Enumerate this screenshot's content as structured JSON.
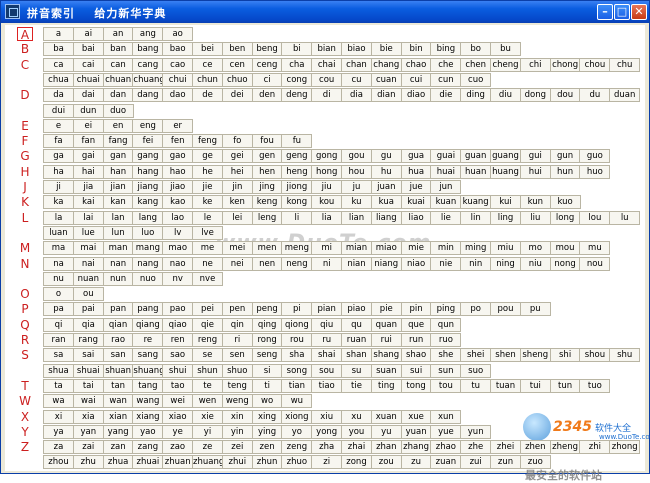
{
  "window": {
    "title": "拼音索引    给力新华字典",
    "minimize_icon": "minimize-icon",
    "maximize_icon": "maximize-icon",
    "close_icon": "close-icon"
  },
  "watermark": {
    "text": "www.DuoTe.com",
    "logo_nums": "2345",
    "logo_brand": "软件大全",
    "logo_sub": "www.DuoTe.com",
    "bottom_text": "最安全的软件站"
  },
  "rows": [
    {
      "letter": "A",
      "syllables": [
        "a",
        "ai",
        "an",
        "ang",
        "ao"
      ]
    },
    {
      "letter": "B",
      "syllables": [
        "ba",
        "bai",
        "ban",
        "bang",
        "bao",
        "bei",
        "ben",
        "beng",
        "bi",
        "bian",
        "biao",
        "bie",
        "bin",
        "bing",
        "bo",
        "bu"
      ]
    },
    {
      "letter": "C",
      "syllables": [
        "ca",
        "cai",
        "can",
        "cang",
        "cao",
        "ce",
        "cen",
        "ceng",
        "cha",
        "chai",
        "chan",
        "chang",
        "chao",
        "che",
        "chen",
        "cheng",
        "chi",
        "chong",
        "chou",
        "chu"
      ]
    },
    {
      "letter": "",
      "syllables": [
        "chua",
        "chuai",
        "chuan",
        "chuang",
        "chui",
        "chun",
        "chuo",
        "ci",
        "cong",
        "cou",
        "cu",
        "cuan",
        "cui",
        "cun",
        "cuo"
      ]
    },
    {
      "letter": "D",
      "syllables": [
        "da",
        "dai",
        "dan",
        "dang",
        "dao",
        "de",
        "dei",
        "den",
        "deng",
        "di",
        "dia",
        "dian",
        "diao",
        "die",
        "ding",
        "diu",
        "dong",
        "dou",
        "du",
        "duan"
      ]
    },
    {
      "letter": "",
      "syllables": [
        "dui",
        "dun",
        "duo"
      ]
    },
    {
      "letter": "E",
      "syllables": [
        "e",
        "ei",
        "en",
        "eng",
        "er"
      ]
    },
    {
      "letter": "F",
      "syllables": [
        "fa",
        "fan",
        "fang",
        "fei",
        "fen",
        "feng",
        "fo",
        "fou",
        "fu"
      ]
    },
    {
      "letter": "G",
      "syllables": [
        "ga",
        "gai",
        "gan",
        "gang",
        "gao",
        "ge",
        "gei",
        "gen",
        "geng",
        "gong",
        "gou",
        "gu",
        "gua",
        "guai",
        "guan",
        "guang",
        "gui",
        "gun",
        "guo"
      ]
    },
    {
      "letter": "H",
      "syllables": [
        "ha",
        "hai",
        "han",
        "hang",
        "hao",
        "he",
        "hei",
        "hen",
        "heng",
        "hong",
        "hou",
        "hu",
        "hua",
        "huai",
        "huan",
        "huang",
        "hui",
        "hun",
        "huo"
      ]
    },
    {
      "letter": "J",
      "syllables": [
        "ji",
        "jia",
        "jian",
        "jiang",
        "jiao",
        "jie",
        "jin",
        "jing",
        "jiong",
        "jiu",
        "ju",
        "juan",
        "jue",
        "jun"
      ]
    },
    {
      "letter": "K",
      "syllables": [
        "ka",
        "kai",
        "kan",
        "kang",
        "kao",
        "ke",
        "ken",
        "keng",
        "kong",
        "kou",
        "ku",
        "kua",
        "kuai",
        "kuan",
        "kuang",
        "kui",
        "kun",
        "kuo"
      ]
    },
    {
      "letter": "L",
      "syllables": [
        "la",
        "lai",
        "lan",
        "lang",
        "lao",
        "le",
        "lei",
        "leng",
        "li",
        "lia",
        "lian",
        "liang",
        "liao",
        "lie",
        "lin",
        "ling",
        "liu",
        "long",
        "lou",
        "lu"
      ]
    },
    {
      "letter": "",
      "syllables": [
        "luan",
        "lue",
        "lun",
        "luo",
        "lv",
        "lve"
      ]
    },
    {
      "letter": "M",
      "syllables": [
        "ma",
        "mai",
        "man",
        "mang",
        "mao",
        "me",
        "mei",
        "men",
        "meng",
        "mi",
        "mian",
        "miao",
        "mie",
        "min",
        "ming",
        "miu",
        "mo",
        "mou",
        "mu"
      ]
    },
    {
      "letter": "N",
      "syllables": [
        "na",
        "nai",
        "nan",
        "nang",
        "nao",
        "ne",
        "nei",
        "nen",
        "neng",
        "ni",
        "nian",
        "niang",
        "niao",
        "nie",
        "nin",
        "ning",
        "niu",
        "nong",
        "nou"
      ]
    },
    {
      "letter": "",
      "syllables": [
        "nu",
        "nuan",
        "nun",
        "nuo",
        "nv",
        "nve"
      ]
    },
    {
      "letter": "O",
      "syllables": [
        "o",
        "ou"
      ]
    },
    {
      "letter": "P",
      "syllables": [
        "pa",
        "pai",
        "pan",
        "pang",
        "pao",
        "pei",
        "pen",
        "peng",
        "pi",
        "pian",
        "piao",
        "pie",
        "pin",
        "ping",
        "po",
        "pou",
        "pu"
      ]
    },
    {
      "letter": "Q",
      "syllables": [
        "qi",
        "qia",
        "qian",
        "qiang",
        "qiao",
        "qie",
        "qin",
        "qing",
        "qiong",
        "qiu",
        "qu",
        "quan",
        "que",
        "qun"
      ]
    },
    {
      "letter": "R",
      "syllables": [
        "ran",
        "rang",
        "rao",
        "re",
        "ren",
        "reng",
        "ri",
        "rong",
        "rou",
        "ru",
        "ruan",
        "rui",
        "run",
        "ruo"
      ]
    },
    {
      "letter": "S",
      "syllables": [
        "sa",
        "sai",
        "san",
        "sang",
        "sao",
        "se",
        "sen",
        "seng",
        "sha",
        "shai",
        "shan",
        "shang",
        "shao",
        "she",
        "shei",
        "shen",
        "sheng",
        "shi",
        "shou",
        "shu"
      ]
    },
    {
      "letter": "",
      "syllables": [
        "shua",
        "shuai",
        "shuan",
        "shuang",
        "shui",
        "shun",
        "shuo",
        "si",
        "song",
        "sou",
        "su",
        "suan",
        "sui",
        "sun",
        "suo"
      ]
    },
    {
      "letter": "T",
      "syllables": [
        "ta",
        "tai",
        "tan",
        "tang",
        "tao",
        "te",
        "teng",
        "ti",
        "tian",
        "tiao",
        "tie",
        "ting",
        "tong",
        "tou",
        "tu",
        "tuan",
        "tui",
        "tun",
        "tuo"
      ]
    },
    {
      "letter": "W",
      "syllables": [
        "wa",
        "wai",
        "wan",
        "wang",
        "wei",
        "wen",
        "weng",
        "wo",
        "wu"
      ]
    },
    {
      "letter": "X",
      "syllables": [
        "xi",
        "xia",
        "xian",
        "xiang",
        "xiao",
        "xie",
        "xin",
        "xing",
        "xiong",
        "xiu",
        "xu",
        "xuan",
        "xue",
        "xun"
      ]
    },
    {
      "letter": "Y",
      "syllables": [
        "ya",
        "yan",
        "yang",
        "yao",
        "ye",
        "yi",
        "yin",
        "ying",
        "yo",
        "yong",
        "you",
        "yu",
        "yuan",
        "yue",
        "yun"
      ]
    },
    {
      "letter": "Z",
      "syllables": [
        "za",
        "zai",
        "zan",
        "zang",
        "zao",
        "ze",
        "zei",
        "zen",
        "zeng",
        "zha",
        "zhai",
        "zhan",
        "zhang",
        "zhao",
        "zhe",
        "zhei",
        "zhen",
        "zheng",
        "zhi",
        "zhong"
      ]
    },
    {
      "letter": "",
      "syllables": [
        "zhou",
        "zhu",
        "zhua",
        "zhuai",
        "zhuan",
        "zhuang",
        "zhui",
        "zhun",
        "zhuo",
        "zi",
        "zong",
        "zou",
        "zu",
        "zuan",
        "zui",
        "zun",
        "zuo"
      ]
    }
  ]
}
